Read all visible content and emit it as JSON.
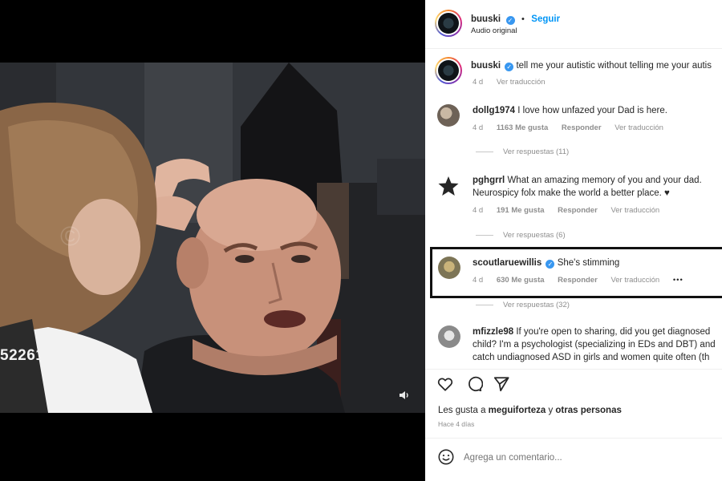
{
  "video": {
    "watermark_number": "52261"
  },
  "header": {
    "username": "buuski",
    "follow_label": "Seguir",
    "subtitle": "Audio original"
  },
  "caption": {
    "username": "buuski",
    "text": "tell me your autistic without telling me your autis",
    "time": "4 d",
    "translate": "Ver traducción"
  },
  "comments": [
    {
      "username": "dollg1974",
      "text": "I love how unfazed your Dad is here.",
      "text2": "",
      "time": "4 d",
      "likes": "1163 Me gusta",
      "reply": "Responder",
      "translate": "Ver traducción",
      "replies": "Ver respuestas (11)",
      "verified": false
    },
    {
      "username": "pghgrrl",
      "text": "What an amazing memory of you and your dad.",
      "text2": "Neurospicy folx make the world a better place. ♥",
      "time": "4 d",
      "likes": "191 Me gusta",
      "reply": "Responder",
      "translate": "Ver traducción",
      "replies": "Ver respuestas (6)",
      "verified": false
    },
    {
      "username": "scoutlaruewillis",
      "text": "She's stimming",
      "text2": "",
      "time": "4 d",
      "likes": "630 Me gusta",
      "reply": "Responder",
      "translate": "Ver traducción",
      "more": "•••",
      "replies": "Ver respuestas (32)",
      "verified": true
    },
    {
      "username": "mfizzle98",
      "text": "If you're open to sharing, did you get diagnosed",
      "text2": "child? I'm a psychologist (specializing in EDs and DBT) and",
      "text3": "catch undiagnosed ASD in girls and women quite often (th",
      "verified": false
    }
  ],
  "likes_line": {
    "prefix": "Les gusta a",
    "user": "meguiforteza",
    "connector": "y",
    "others": "otras personas"
  },
  "posted": "Hace 4 días",
  "comment_box": {
    "placeholder": "Agrega un comentario..."
  },
  "icons": {
    "like": "heart-icon",
    "comment": "comment-bubble-icon",
    "share": "send-icon",
    "emoji": "emoji-icon",
    "volume": "volume-icon",
    "verified": "verified-badge-icon",
    "star_avatar": "star-icon"
  },
  "colors": {
    "verified_blue": "#3897f0",
    "link_blue": "#0095f6",
    "text_primary": "#262626",
    "text_secondary": "#8e8e8e"
  }
}
